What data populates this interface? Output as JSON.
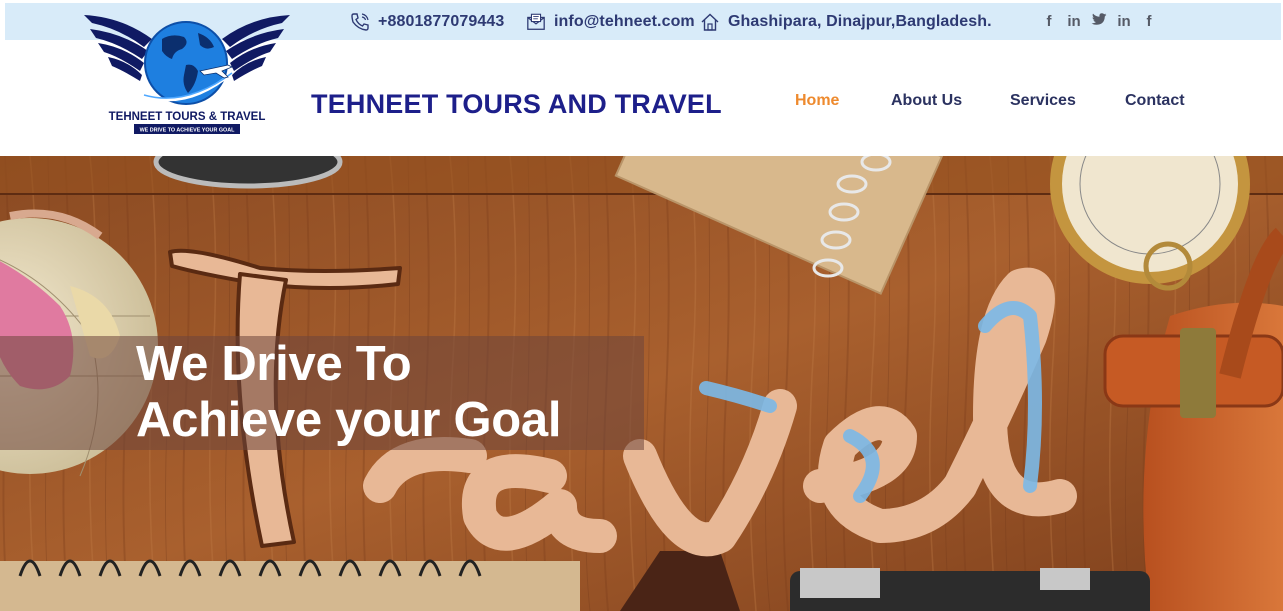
{
  "topbar": {
    "phone": "+8801877079443",
    "email": "info@tehneet.com",
    "address": "Ghashipara, Dinajpur,Bangladesh.",
    "phone_icon": "phone-icon",
    "email_icon": "mail-icon",
    "address_icon": "home-icon",
    "social": [
      {
        "icon": "facebook-icon",
        "glyph": "f"
      },
      {
        "icon": "linkedin-icon",
        "glyph": "in"
      },
      {
        "icon": "twitter-icon",
        "glyph": "🐦"
      },
      {
        "icon": "linkedin-icon",
        "glyph": "in"
      },
      {
        "icon": "facebook-icon",
        "glyph": "f"
      }
    ]
  },
  "logo": {
    "name": "TEHNEET TOURS & TRAVEL",
    "tagline": "WE DRIVE TO ACHIEVE YOUR GOAL"
  },
  "header": {
    "brand_title": "TEHNEET TOURS AND TRAVEL"
  },
  "nav": {
    "items": [
      {
        "label": "Home",
        "active": true
      },
      {
        "label": "About Us",
        "active": false
      },
      {
        "label": "Services",
        "active": false
      },
      {
        "label": "Contact",
        "active": false
      }
    ]
  },
  "hero": {
    "line1": "We Drive To",
    "line2": "Achieve your Goal",
    "art_text": "Travel"
  },
  "colors": {
    "brand_blue": "#1d1f8a",
    "nav_active": "#ee8a2e",
    "nav_text": "#2b3260",
    "topbar_bg": "#d8ebf9",
    "wood": "#a0562a"
  }
}
